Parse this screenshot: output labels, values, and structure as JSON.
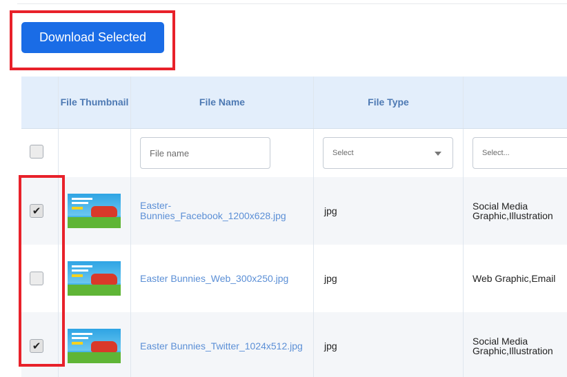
{
  "toolbar": {
    "download_label": "Download Selected"
  },
  "table": {
    "headers": {
      "thumbnail": "File Thumbnail",
      "file_name": "File Name",
      "file_type": "File Type",
      "category": ""
    },
    "filters": {
      "file_name_placeholder": "File name",
      "file_type_select": "Select",
      "category_select": "Select..."
    },
    "rows": [
      {
        "checked": true,
        "name": "Easter-Bunnies_Facebook_1200x628.jpg",
        "type": "jpg",
        "category_line1": "Social Media",
        "category_line2": "Graphic,Illustration"
      },
      {
        "checked": false,
        "name": "Easter Bunnies_Web_300x250.jpg",
        "type": "jpg",
        "category_line1": "Web Graphic,Email",
        "category_line2": ""
      },
      {
        "checked": true,
        "name": "Easter Bunnies_Twitter_1024x512.jpg",
        "type": "jpg",
        "category_line1": "Social Media",
        "category_line2": "Graphic,Illustration"
      }
    ]
  },
  "colors": {
    "accent": "#1a6ce6",
    "highlight": "#e8212a",
    "link": "#5b8fd6",
    "header_bg": "#e3eefb"
  },
  "icons": {
    "check": "checkmark-icon",
    "dropdown": "chevron-down-icon"
  }
}
